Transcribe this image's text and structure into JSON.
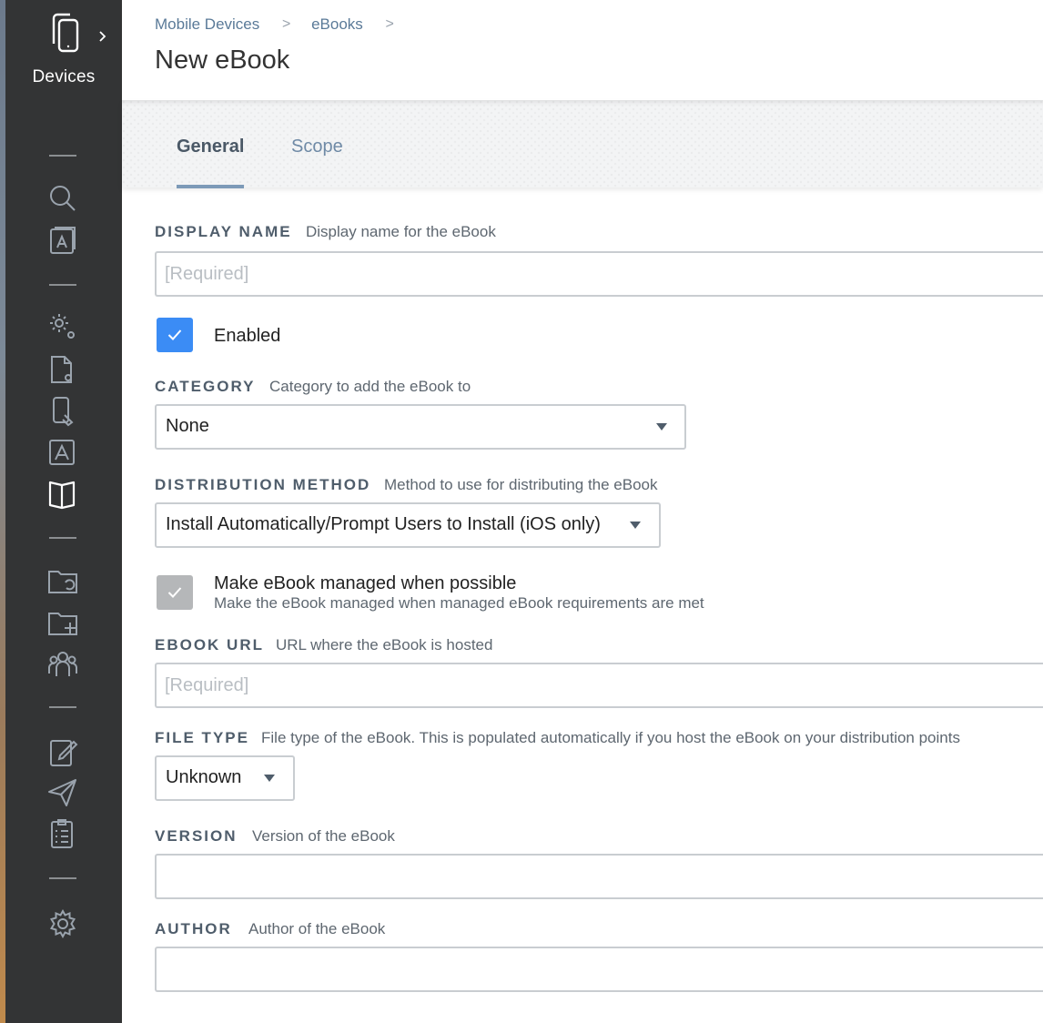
{
  "sidebar": {
    "section_label": "Devices",
    "icons": [
      "search-icon",
      "app-catalog-icon",
      "settings-gear-icon",
      "config-profile-icon",
      "mobile-device-icon",
      "app-store-icon",
      "book-icon",
      "folder-sync-icon",
      "folder-add-icon",
      "users-group-icon",
      "enrollment-edit-icon",
      "send-icon",
      "inventory-clipboard-icon",
      "settings-icon"
    ]
  },
  "breadcrumb": {
    "item1": "Mobile Devices",
    "item2": "eBooks",
    "separator": ">"
  },
  "page": {
    "title": "New eBook"
  },
  "tabs": {
    "general": "General",
    "scope": "Scope"
  },
  "form": {
    "display_name": {
      "label": "DISPLAY NAME",
      "hint": "Display name for the eBook",
      "placeholder": "[Required]",
      "value": ""
    },
    "enabled": {
      "label": "Enabled",
      "checked": true
    },
    "category": {
      "label": "CATEGORY",
      "hint": "Category to add the eBook to",
      "value": "None"
    },
    "distribution_method": {
      "label": "DISTRIBUTION METHOD",
      "hint": "Method to use for distributing the eBook",
      "value": "Install Automatically/Prompt Users to Install (iOS only)"
    },
    "managed": {
      "label": "Make eBook managed when possible",
      "sub": "Make the eBook managed when managed eBook requirements are met",
      "checked": true,
      "disabled": true
    },
    "ebook_url": {
      "label": "EBOOK URL",
      "hint": "URL where the eBook is hosted",
      "placeholder": "[Required]",
      "value": ""
    },
    "file_type": {
      "label": "FILE TYPE",
      "hint": "File type of the eBook. This is populated automatically if you host the eBook on your distribution points",
      "value": "Unknown"
    },
    "version": {
      "label": "VERSION",
      "hint": "Version of the eBook",
      "value": ""
    },
    "author": {
      "label": "AUTHOR",
      "hint": "Author of the eBook",
      "value": ""
    }
  },
  "colors": {
    "sidebar_bg": "#333435",
    "accent_blue": "#3b8cf5",
    "label_slate": "#4f5d6b",
    "link_blue": "#5a7a98",
    "checkbox_disabled": "#b5b7b9"
  }
}
